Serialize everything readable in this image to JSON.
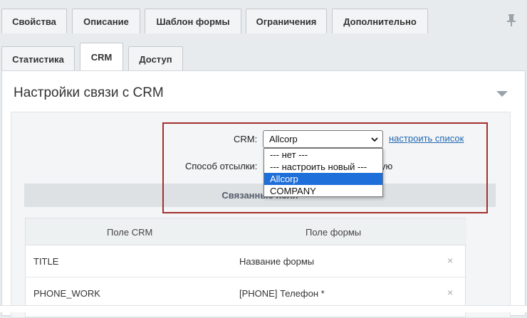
{
  "tabs_row1": [
    {
      "label": "Свойства"
    },
    {
      "label": "Описание"
    },
    {
      "label": "Шаблон формы"
    },
    {
      "label": "Ограничения"
    },
    {
      "label": "Дополнительно"
    }
  ],
  "tabs_row2": [
    {
      "label": "Статистика"
    },
    {
      "label": "CRM"
    },
    {
      "label": "Доступ"
    }
  ],
  "panel": {
    "title": "Настройки связи с CRM"
  },
  "crm": {
    "label": "CRM:",
    "selected": "Allcorp",
    "configure_link": "настроить список",
    "options": [
      "--- нет ---",
      "--- настроить новый ---",
      "Allcorp",
      "COMPANY"
    ],
    "highlighted_option": "Allcorp"
  },
  "send_method": {
    "label": "Способ отсылки:",
    "value_fragment": "ую"
  },
  "section": {
    "title": "Связанные поля"
  },
  "table": {
    "headers": [
      "Поле CRM",
      "Поле формы"
    ],
    "rows": [
      {
        "crm_field": "TITLE",
        "form_field": "Название формы"
      },
      {
        "crm_field": "PHONE_WORK",
        "form_field": "[PHONE] Телефон *"
      }
    ],
    "delete_glyph": "×"
  },
  "colors": {
    "highlight_border": "#a32f2f",
    "link": "#2067b0",
    "selected_option": "#1e6fd9"
  }
}
